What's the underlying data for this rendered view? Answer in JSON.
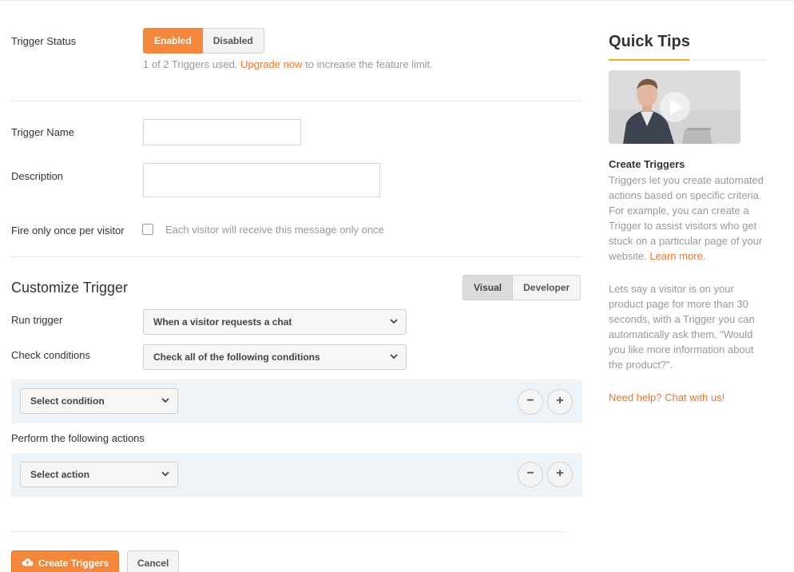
{
  "form": {
    "trigger_status_label": "Trigger Status",
    "status_enabled": "Enabled",
    "status_disabled": "Disabled",
    "usage_text": "1 of 2 Triggers used.",
    "upgrade_link": "Upgrade now",
    "usage_suffix": "to increase the feature limit.",
    "trigger_name_label": "Trigger Name",
    "trigger_name_value": "",
    "description_label": "Description",
    "description_value": "",
    "fire_once_label": "Fire only once per visitor",
    "fire_once_text": "Each visitor will receive this message only once",
    "fire_once_checked": false
  },
  "customize": {
    "title": "Customize Trigger",
    "mode_visual": "Visual",
    "mode_developer": "Developer",
    "run_trigger_label": "Run trigger",
    "run_trigger_value": "When a visitor requests a chat",
    "check_conditions_label": "Check conditions",
    "check_conditions_value": "Check all of the following conditions",
    "condition_select": "Select condition",
    "actions_label": "Perform the following actions",
    "action_select": "Select action",
    "remove_symbol": "−",
    "add_symbol": "+"
  },
  "footer": {
    "create_button": "Create Triggers",
    "cancel_button": "Cancel"
  },
  "sidebar": {
    "title": "Quick Tips",
    "section_title": "Create Triggers",
    "para1": "Triggers let you create automated actions based on specific criteria. For example, you can create a Trigger to assist visitors who get stuck on a particular page of your website.",
    "learn_more": "Learn more.",
    "para2": "Lets say a visitor is on your product page for more than 30 seconds, with a Trigger you can automatically ask them, “Would you like more information about the product?”.",
    "help_link": "Need help? Chat with us!"
  },
  "colors": {
    "accent": "#f5873a",
    "link": "#f0742a",
    "tips_underline": "#f5a623",
    "panel_bg": "#eef3f8"
  }
}
